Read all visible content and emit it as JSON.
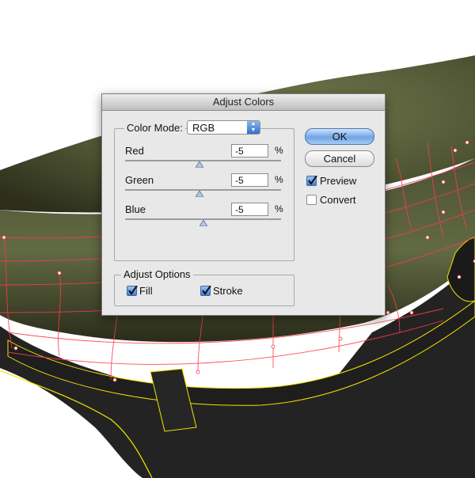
{
  "dialog": {
    "title": "Adjust Colors",
    "color_mode": {
      "label": "Color Mode:",
      "value": "RGB"
    },
    "channels": [
      {
        "label": "Red",
        "value": "-5",
        "unit": "%"
      },
      {
        "label": "Green",
        "value": "-5",
        "unit": "%"
      },
      {
        "label": "Blue",
        "value": "-5",
        "unit": "%"
      }
    ],
    "buttons": {
      "ok": "OK",
      "cancel": "Cancel"
    },
    "preview": {
      "label": "Preview",
      "checked": true
    },
    "convert": {
      "label": "Convert",
      "checked": false
    },
    "adjust_options": {
      "label": "Adjust Options",
      "fill": {
        "label": "Fill",
        "checked": true
      },
      "stroke": {
        "label": "Stroke",
        "checked": true
      }
    }
  },
  "colors": {
    "cap_olive": "#5e6441",
    "cap_band": "#232323",
    "mesh_lines": "#ff3b4c",
    "outline_yellow": "#f2e400",
    "accent_blue": "#3c7bd6"
  }
}
